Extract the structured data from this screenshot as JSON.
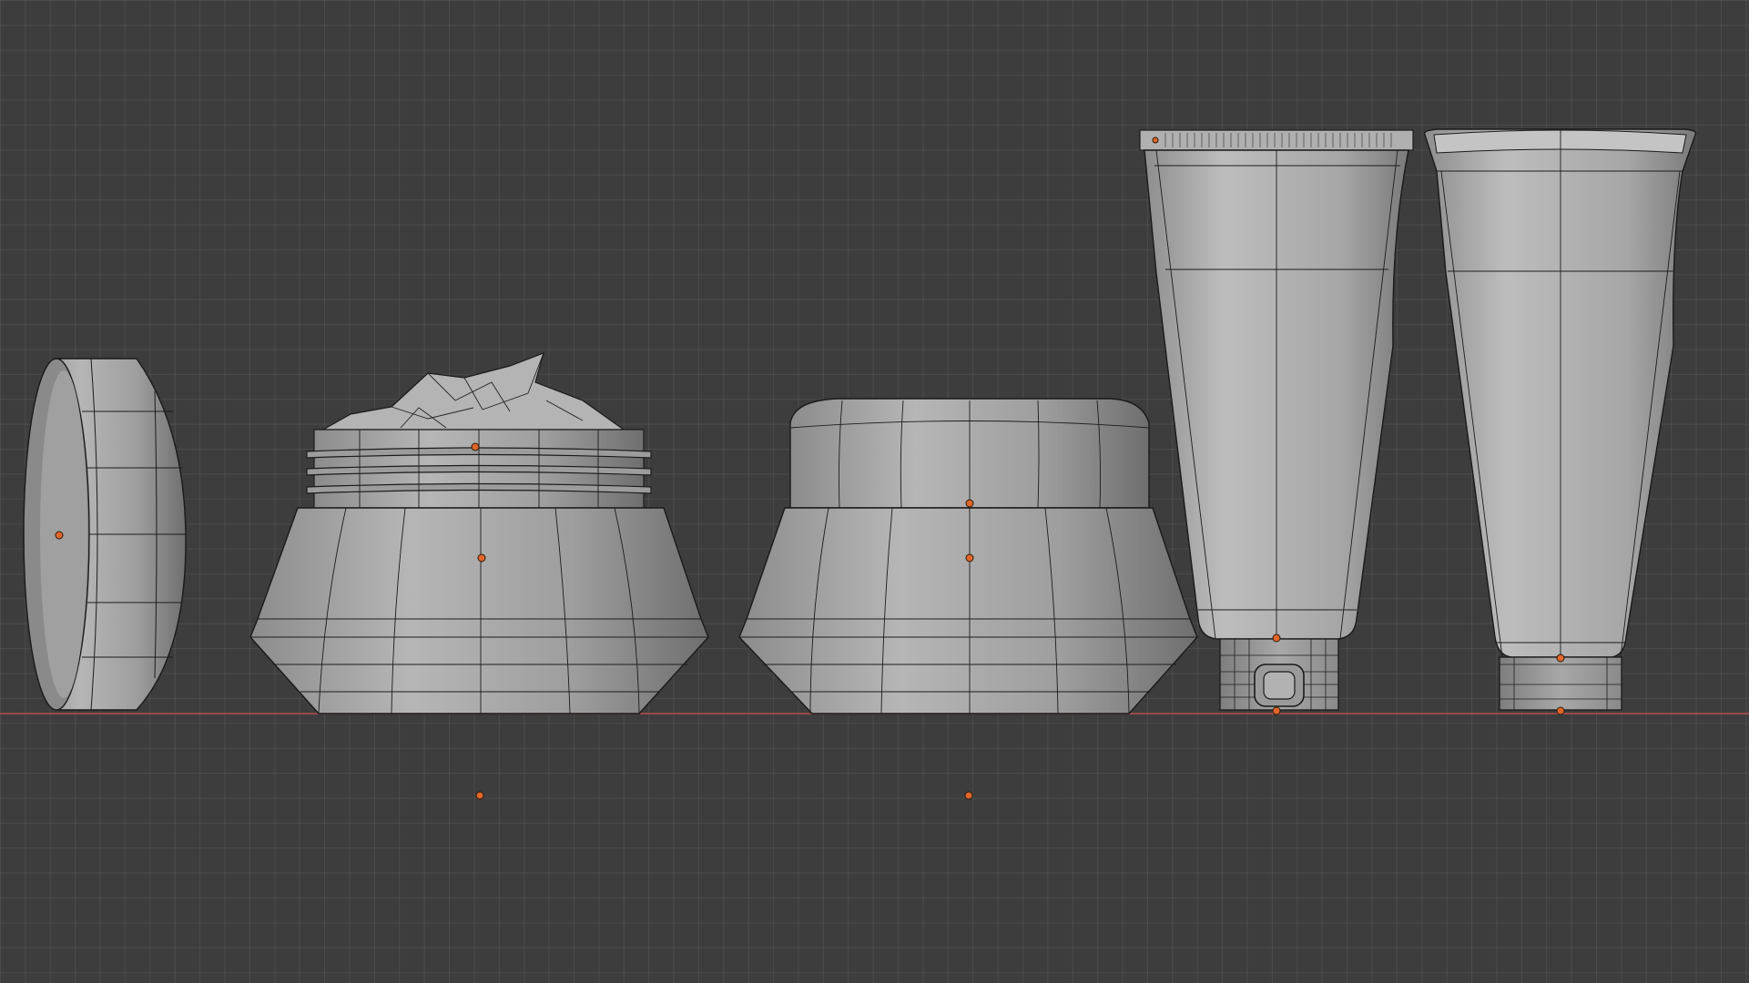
{
  "viewport": {
    "mode": "orthographic-front",
    "background_color": "#3d3d3d",
    "grid_line_color": "#4a4a4a",
    "ground_axis_color": "#c0504d",
    "mesh_fill_color": "#a9a9a9",
    "wire_color": "#1a1a1a",
    "origin_color": "#e0662a"
  },
  "objects": [
    {
      "name": "jar-lid-side",
      "type": "mesh"
    },
    {
      "name": "jar-with-cream",
      "type": "mesh"
    },
    {
      "name": "jar-closed",
      "type": "mesh"
    },
    {
      "name": "tube-open-cap",
      "type": "mesh"
    },
    {
      "name": "tube-closed",
      "type": "mesh"
    }
  ]
}
